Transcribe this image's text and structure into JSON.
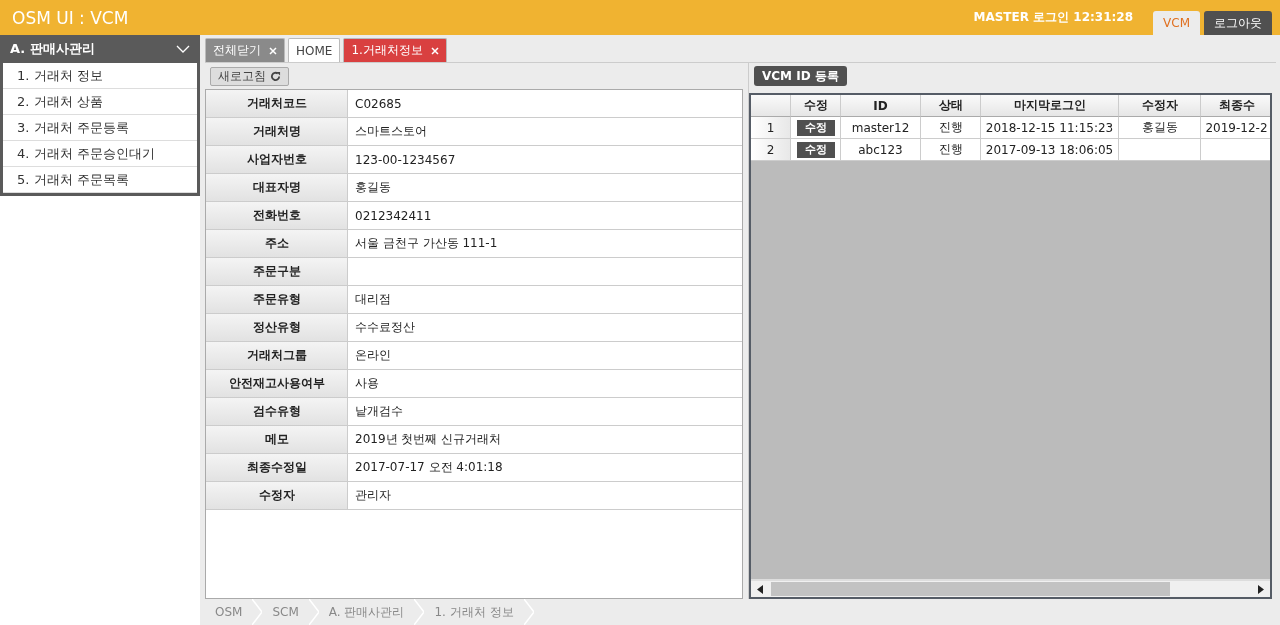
{
  "header": {
    "title": "OSM UI : VCM",
    "login_info": "MASTER 로그인 12:31:28",
    "buttons": [
      {
        "label": "VCM",
        "selected": true
      },
      {
        "label": "로그아웃",
        "selected": false
      }
    ]
  },
  "sidebar": {
    "group": {
      "label": "A. 판매사관리",
      "expanded": true
    },
    "items": [
      {
        "label": "1. 거래처 정보"
      },
      {
        "label": "2. 거래처 상품"
      },
      {
        "label": "3. 거래처 주문등록"
      },
      {
        "label": "4. 거래처 주문승인대기"
      },
      {
        "label": "5. 거래처 주문목록"
      }
    ]
  },
  "tabs": [
    {
      "label": "전체닫기",
      "kind": "action",
      "closable": true,
      "selected": false
    },
    {
      "label": "HOME",
      "kind": "tab",
      "closable": false,
      "selected": false
    },
    {
      "label": "1.거래처정보",
      "kind": "tab",
      "closable": true,
      "selected": true
    }
  ],
  "detail": {
    "refresh_button": "새로고침",
    "fields": [
      {
        "label": "거래처코드",
        "value": "C02685"
      },
      {
        "label": "거래처명",
        "value": "스마트스토어"
      },
      {
        "label": "사업자번호",
        "value": "123-00-1234567"
      },
      {
        "label": "대표자명",
        "value": "홍길동"
      },
      {
        "label": "전화번호",
        "value": "0212342411"
      },
      {
        "label": "주소",
        "value": "서울 금천구 가산동 111-1"
      },
      {
        "label": "주문구분"
      },
      {
        "label": "주문유형",
        "value": "대리점"
      },
      {
        "label": "정산유형",
        "value": "수수료정산"
      },
      {
        "label": "거래처그룹",
        "value": "온라인"
      },
      {
        "label": "안전재고사용여부",
        "value": "사용"
      },
      {
        "label": "검수유형",
        "value": "낱개검수"
      },
      {
        "label": "메모",
        "value": "2019년 첫번째 신규거래처"
      },
      {
        "label": "최종수정일",
        "value": "2017-07-17 오전 4:01:18"
      },
      {
        "label": "수정자",
        "value": "관리자"
      }
    ]
  },
  "vcm": {
    "register_button": "VCM ID 등록",
    "table": {
      "columns": [
        "수정",
        "ID",
        "상태",
        "마지막로그인",
        "수정자",
        "최종수"
      ],
      "rows": [
        {
          "row_number": "1",
          "cells": [
            "수정",
            "master12",
            "진행",
            "2018-12-15 11:15:23",
            "홍길동",
            "2019-12-2"
          ]
        },
        {
          "row_number": "2",
          "cells": [
            "수정",
            "abc123",
            "진행",
            "2017-09-13 18:06:05",
            "",
            ""
          ]
        }
      ]
    }
  },
  "breadcrumb": [
    "OSM",
    "SCM",
    "A. 판매사관리",
    "1. 거래처 정보"
  ]
}
